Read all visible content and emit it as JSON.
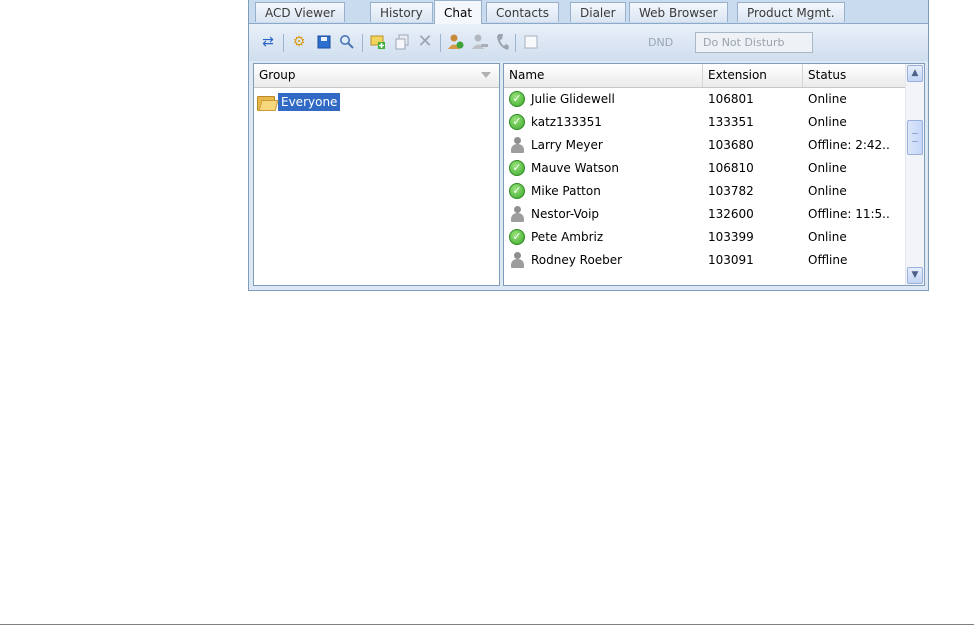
{
  "tabs": [
    "ACD Viewer",
    "History",
    "Chat",
    "Contacts",
    "Dialer",
    "Web Browser",
    "Product Mgmt."
  ],
  "active_tab": "Chat",
  "toolbar": {
    "icons": [
      "expand-icon",
      "gear-icon",
      "save-icon",
      "search-icon",
      "add-chat-icon",
      "copy-icon",
      "delete-icon",
      "add-user-icon",
      "remove-user-icon",
      "phone-icon",
      "checkbox-icon"
    ],
    "dnd_label": "DND",
    "dnd_button": "Do Not Disturb"
  },
  "group_pane": {
    "header": "Group",
    "items": [
      {
        "label": "Everyone",
        "selected": true
      }
    ]
  },
  "contacts": {
    "columns": [
      "Name",
      "Extension",
      "Status"
    ],
    "rows": [
      {
        "name": "Julie Glidewell",
        "extension": "106801",
        "status": "Online",
        "online": true
      },
      {
        "name": "katz133351",
        "extension": "133351",
        "status": "Online",
        "online": true
      },
      {
        "name": "Larry Meyer",
        "extension": "103680",
        "status": "Offline: 2:42..",
        "online": false
      },
      {
        "name": "Mauve Watson",
        "extension": "106810",
        "status": "Online",
        "online": true
      },
      {
        "name": "Mike Patton",
        "extension": "103782",
        "status": "Online",
        "online": true
      },
      {
        "name": "Nestor-Voip",
        "extension": "132600",
        "status": "Offline: 11:5..",
        "online": false
      },
      {
        "name": "Pete Ambriz",
        "extension": "103399",
        "status": "Online",
        "online": true
      },
      {
        "name": "Rodney Roeber",
        "extension": "103091",
        "status": "Offline",
        "online": false
      }
    ]
  },
  "colors": {
    "selection": "#316ac5",
    "online": "#3aa82a",
    "frame": "#dde8f5"
  }
}
